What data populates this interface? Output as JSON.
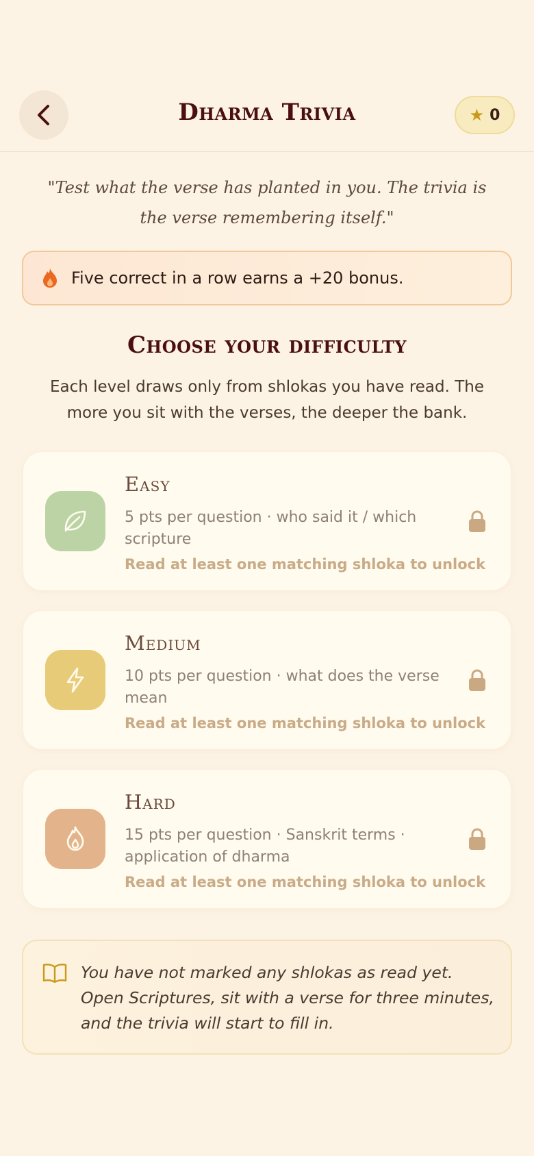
{
  "header": {
    "title": "Dharma Trivia",
    "points": "0"
  },
  "quote": "\"Test what the verse has planted in you. The trivia is the verse remembering itself.\"",
  "streak_banner": "Five correct in a row earns a +20 bonus.",
  "section": {
    "title": "Choose your difficulty",
    "subtitle": "Each level draws only from shlokas you have read. The more you sit with the verses, the deeper the bank."
  },
  "levels": [
    {
      "name": "Easy",
      "description": "5 pts per question · who said it / which scripture",
      "unlock_hint": "Read at least one matching shloka to unlock",
      "icon": "leaf-icon",
      "color": "#bcd3a6"
    },
    {
      "name": "Medium",
      "description": "10 pts per question · what does the verse mean",
      "unlock_hint": "Read at least one matching shloka to unlock",
      "icon": "lightning-icon",
      "color": "#e8cb78"
    },
    {
      "name": "Hard",
      "description": "15 pts per question · Sanskrit terms · application of dharma",
      "unlock_hint": "Read at least one matching shloka to unlock",
      "icon": "flame-icon",
      "color": "#e3b48c"
    }
  ],
  "notice": "You have not marked any shlokas as read yet. Open Scriptures, sit with a verse for three minutes, and the trivia will start to fill in.",
  "colors": {
    "background": "#fdf3e4",
    "title": "#4a0f12",
    "accent_star": "#c99a1a",
    "streak_flame": "#e8691f",
    "lock": "#c9a882"
  }
}
